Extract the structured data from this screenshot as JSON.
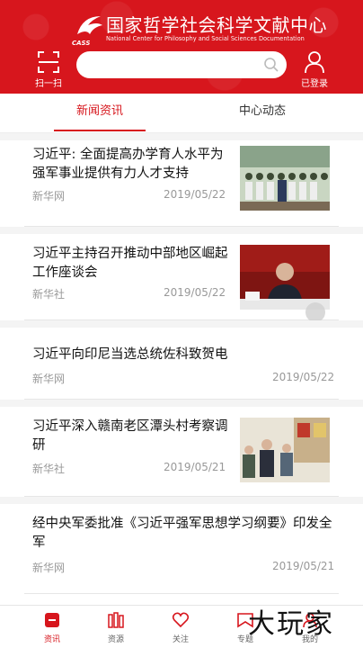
{
  "header": {
    "title": "国家哲学社会科学文献中心",
    "subtitle": "National Center for Philosophy and Social Sciences Documentation",
    "abbr": "CASS",
    "scan_label": "扫一扫",
    "login_label": "已登录",
    "search_placeholder": "",
    "brand_color": "#d7161d"
  },
  "tabs": [
    {
      "label": "新闻资讯",
      "active": true
    },
    {
      "label": "中心动态",
      "active": false
    }
  ],
  "news": [
    {
      "title": "习近平: 全面提高办学育人水平为强军事业提供有力人才支持",
      "source": "新华网",
      "date": "2019/05/22",
      "has_image": true
    },
    {
      "title": "习近平主持召开推动中部地区崛起工作座谈会",
      "source": "新华社",
      "date": "2019/05/22",
      "has_image": true
    },
    {
      "title": "习近平向印尼当选总统佐科致贺电",
      "source": "新华网",
      "date": "2019/05/22",
      "has_image": false
    },
    {
      "title": "习近平深入赣南老区潭头村考察调研",
      "source": "新华社",
      "date": "2019/05/21",
      "has_image": true
    },
    {
      "title": "经中央军委批准《习近平强军思想学习纲要》印发全军",
      "source": "新华网",
      "date": "2019/05/21",
      "has_image": false
    }
  ],
  "bottom_nav": [
    {
      "label": "资讯",
      "icon": "news-icon",
      "active": true
    },
    {
      "label": "资源",
      "icon": "books-icon",
      "active": false
    },
    {
      "label": "关注",
      "icon": "heart-icon",
      "active": false
    },
    {
      "label": "专题",
      "icon": "bookmark-icon",
      "active": false
    },
    {
      "label": "我的",
      "icon": "user-icon",
      "active": false
    }
  ],
  "watermark": "大玩家"
}
